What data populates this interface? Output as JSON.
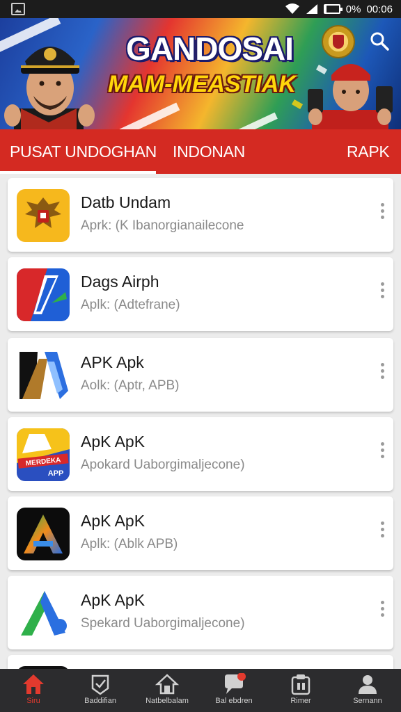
{
  "status_bar": {
    "battery_text": "0%",
    "time": "00:06",
    "battery_level": 0.1
  },
  "header": {
    "title": "GANDOSAI",
    "subtitle": "MAM-MEASTIAK",
    "search_icon": "search-icon",
    "emblem_icon": "emblem-icon"
  },
  "tabs": [
    {
      "label": "PUSAT UNDOGHAN",
      "active": true
    },
    {
      "label": "INDONAN",
      "active": false
    },
    {
      "label": "RAPK",
      "active": false
    }
  ],
  "apps": [
    {
      "name": "Datb Undam",
      "subtitle": "Aprk: (K Ibanorgianailecone",
      "icon": "garuda-icon"
    },
    {
      "name": "Dags Airph",
      "subtitle": "Aplk: (Adtefrane)",
      "icon": "red-blue-app-icon"
    },
    {
      "name": "APK Apk",
      "subtitle": "Aolk: (Aptr, APB)",
      "icon": "blue-document-a-icon"
    },
    {
      "name": "ApK ApK",
      "subtitle": "Apokard Uaborgimaljecone)",
      "icon": "merdeka-app-icon",
      "icon_text_top": "MERDEKA",
      "icon_text_bottom": "APP"
    },
    {
      "name": "ApK ApK",
      "subtitle": "Aplk: (Ablk APB)",
      "icon": "gradient-a-icon"
    },
    {
      "name": "ApK ApK",
      "subtitle": "Spekard Uaborgimaljecone)",
      "icon": "play-a-icon"
    }
  ],
  "bottom_nav": [
    {
      "label": "Siru",
      "icon": "home-icon",
      "active": true
    },
    {
      "label": "Baddifian",
      "icon": "badge-icon",
      "active": false
    },
    {
      "label": "Natbelbalam",
      "icon": "house-icon",
      "active": false
    },
    {
      "label": "Bal ebdren",
      "icon": "chat-icon",
      "active": false
    },
    {
      "label": "Rimer",
      "icon": "clipboard-icon",
      "active": false
    },
    {
      "label": "Sernann",
      "icon": "person-icon",
      "active": false
    }
  ],
  "colors": {
    "primary_red": "#d42a22",
    "nav_background": "#2c2c2e",
    "active_nav": "#e23a2e"
  }
}
